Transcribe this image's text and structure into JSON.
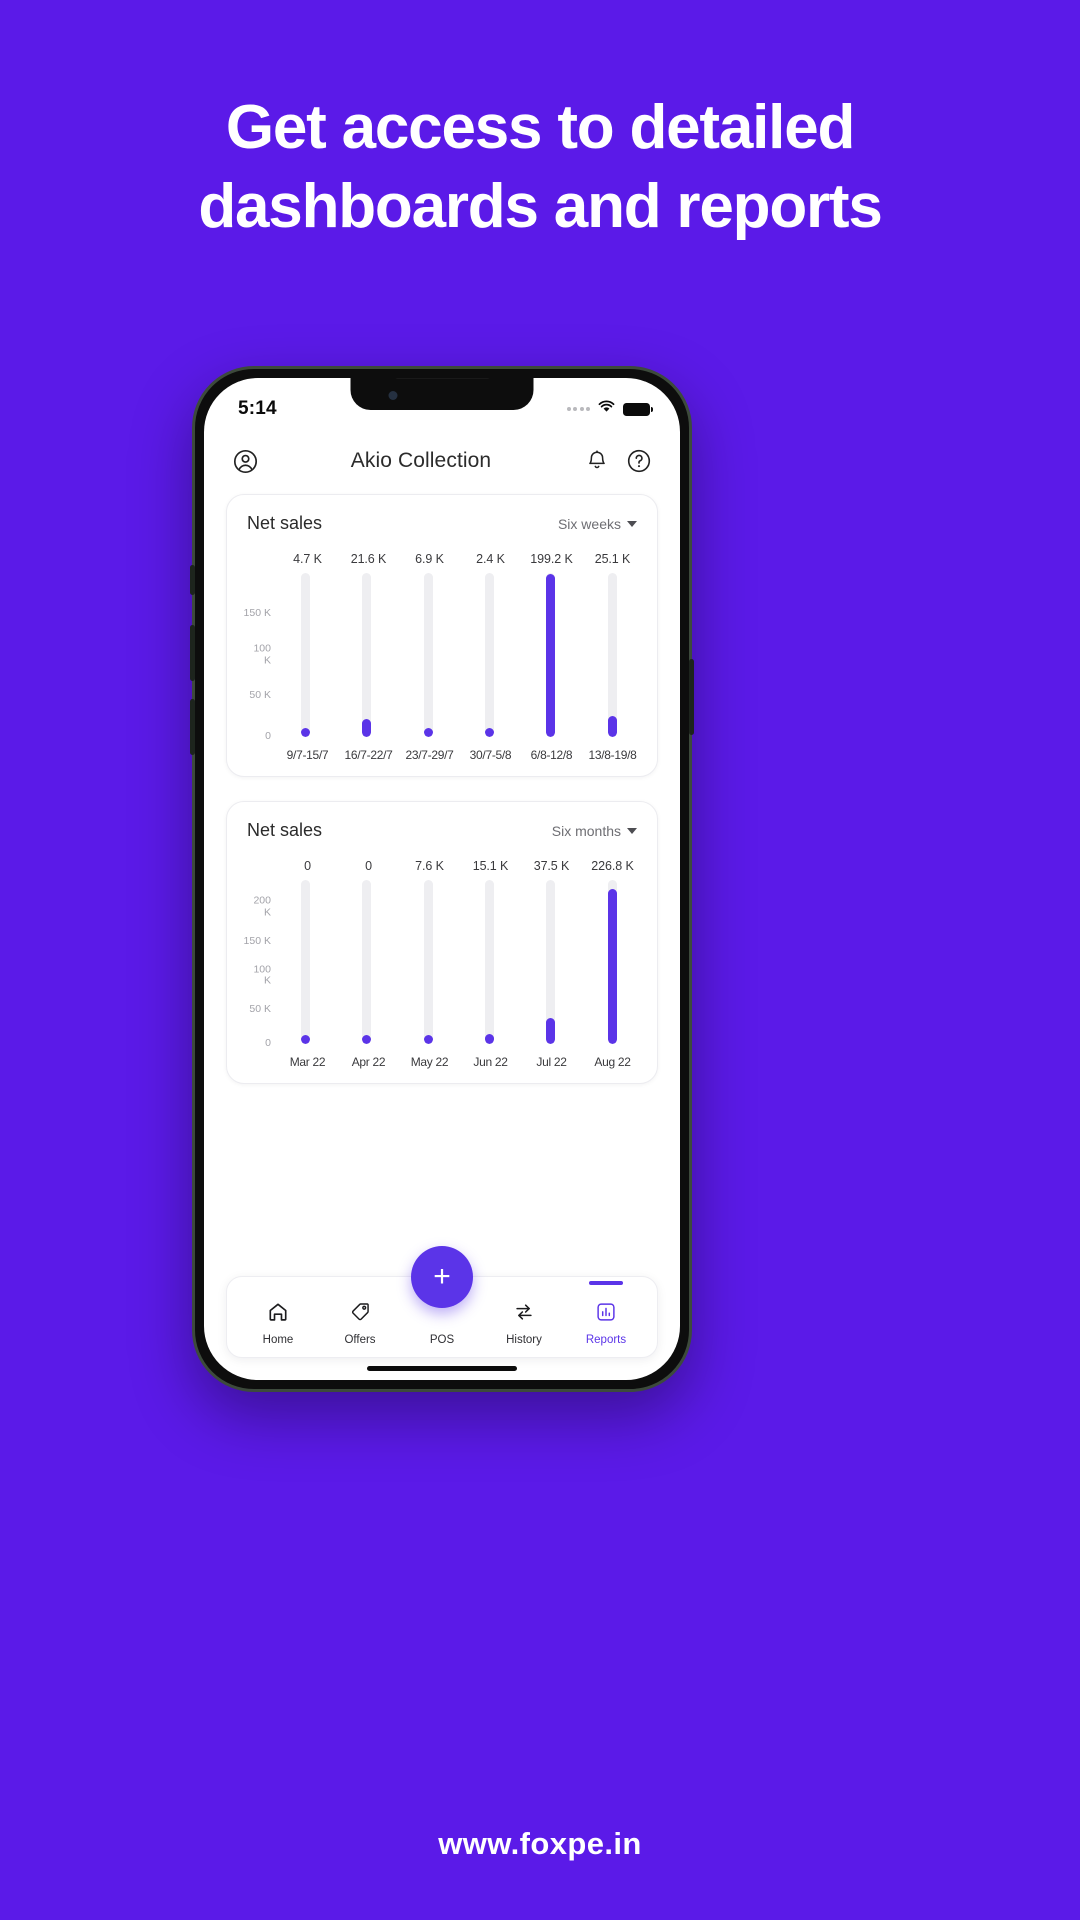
{
  "promo": {
    "headline": "Get access to detailed dashboards and reports",
    "footer_url": "www.foxpe.in",
    "background_color": "#5B1AE8",
    "accent_color": "#5B34E8"
  },
  "phone": {
    "status_bar": {
      "time": "5:14",
      "signal_icon": "signal-dots-icon",
      "wifi_icon": "wifi-icon",
      "battery_icon": "battery-full-icon"
    },
    "app_bar": {
      "profile_icon": "account-circle-icon",
      "title": "Akio Collection",
      "notifications_icon": "bell-icon",
      "help_icon": "help-circle-icon"
    },
    "cards": [
      {
        "title": "Net sales",
        "range_label": "Six weeks",
        "dropdown_icon": "chevron-down-icon"
      },
      {
        "title": "Net sales",
        "range_label": "Six months",
        "dropdown_icon": "chevron-down-icon"
      }
    ],
    "bottom_nav": {
      "fab_label": "+",
      "fab_icon": "plus-icon",
      "items": [
        {
          "label": "Home",
          "icon": "home-icon",
          "active": false
        },
        {
          "label": "Offers",
          "icon": "tag-icon",
          "active": false
        },
        {
          "label": "POS",
          "icon": "plus-icon",
          "active": false
        },
        {
          "label": "History",
          "icon": "swap-arrows-icon",
          "active": false
        },
        {
          "label": "Reports",
          "icon": "bar-chart-icon",
          "active": true
        }
      ]
    }
  },
  "chart_data": [
    {
      "type": "bar",
      "title": "Net sales",
      "subtitle": "Six weeks",
      "orientation": "vertical",
      "categories": [
        "9/7-15/7",
        "16/7-22/7",
        "23/7-29/7",
        "30/7-5/8",
        "6/8-12/8",
        "13/8-19/8"
      ],
      "values": [
        4700,
        21600,
        6900,
        2400,
        199200,
        25100
      ],
      "value_labels": [
        "4.7 K",
        "21.6 K",
        "6.9 K",
        "2.4 K",
        "199.2 K",
        "25.1 K"
      ],
      "ytick_labels": [
        "150 K",
        "100\nK",
        "50 K",
        "0"
      ],
      "ytick_values": [
        150000,
        100000,
        50000,
        0
      ],
      "ylim": [
        0,
        200000
      ],
      "xlabel": "",
      "ylabel": "",
      "grid": false,
      "legend": false,
      "bar_color": "#5B34E8",
      "track_color": "#EEEEF1"
    },
    {
      "type": "bar",
      "title": "Net sales",
      "subtitle": "Six months",
      "orientation": "vertical",
      "categories": [
        "Mar 22",
        "Apr 22",
        "May 22",
        "Jun 22",
        "Jul 22",
        "Aug 22"
      ],
      "values": [
        0,
        0,
        7600,
        15100,
        37500,
        226800
      ],
      "value_labels": [
        "0",
        "0",
        "7.6 K",
        "15.1 K",
        "37.5 K",
        "226.8 K"
      ],
      "ytick_labels": [
        "200\nK",
        "150 K",
        "100\nK",
        "50 K",
        "0"
      ],
      "ytick_values": [
        200000,
        150000,
        100000,
        50000,
        0
      ],
      "ylim": [
        0,
        240000
      ],
      "xlabel": "",
      "ylabel": "",
      "grid": false,
      "legend": false,
      "bar_color": "#5B34E8",
      "track_color": "#EEEEF1"
    }
  ]
}
